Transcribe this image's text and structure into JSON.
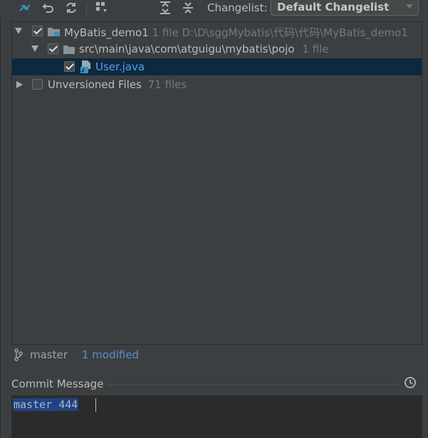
{
  "toolbar": {
    "icons": [
      "compare-icon",
      "rollback-icon",
      "refresh-icon",
      "group-by-icon",
      "expand-all-icon",
      "collapse-all-icon"
    ],
    "changelist_label": "Changelist:",
    "changelist_value": "Default Changelist"
  },
  "tree": {
    "rows": [
      {
        "label": "MyBatis_demo1",
        "meta": "1 file  D:\\D\\sggMybatis\\代码\\代码\\MyBatis_demo1",
        "checked": true,
        "expanded": true
      },
      {
        "label": "src\\main\\java\\com\\atguigu\\mybatis\\pojo",
        "meta": "1 file",
        "checked": true,
        "expanded": true
      },
      {
        "label": "User.java",
        "checked": true,
        "selected": true
      },
      {
        "label": "Unversioned Files",
        "meta": "71 files",
        "checked": false,
        "expanded": false
      }
    ]
  },
  "status": {
    "branch": "master",
    "modified": "1 modified"
  },
  "commit": {
    "label": "Commit Message",
    "message": "master 444"
  },
  "colors": {
    "background": "#3c3f41",
    "selection": "#0d293e",
    "text_selection": "#214283",
    "link": "#5d8ecc",
    "java_file": "#589df6"
  }
}
